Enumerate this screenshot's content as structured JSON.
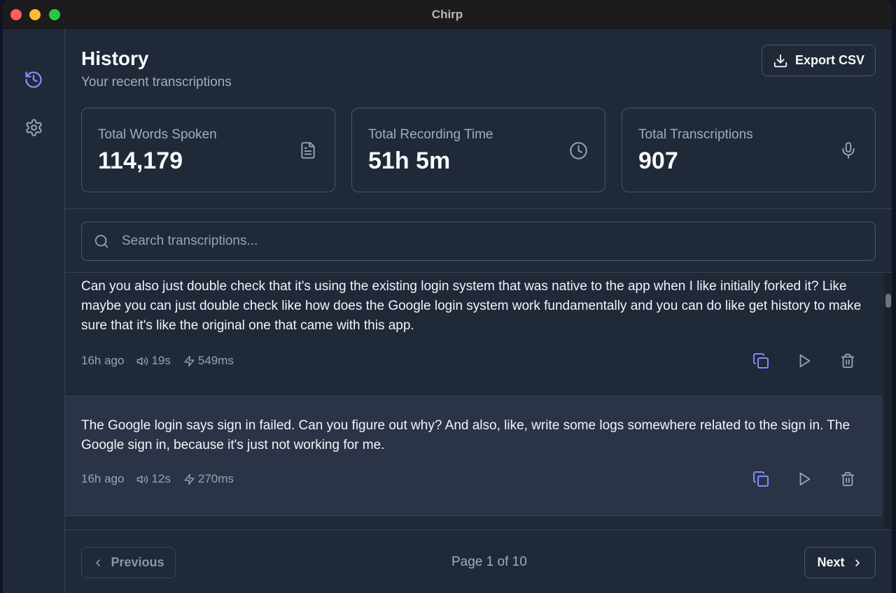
{
  "window": {
    "title": "Chirp"
  },
  "sidebar": {
    "items": [
      {
        "name": "history",
        "icon": "history-icon",
        "active": true
      },
      {
        "name": "settings",
        "icon": "gear-icon",
        "active": false
      }
    ]
  },
  "header": {
    "title": "History",
    "subtitle": "Your recent transcriptions",
    "export_label": "Export CSV"
  },
  "stats": [
    {
      "label": "Total Words Spoken",
      "value": "114,179",
      "icon": "document-icon"
    },
    {
      "label": "Total Recording Time",
      "value": "51h 5m",
      "icon": "clock-icon"
    },
    {
      "label": "Total Transcriptions",
      "value": "907",
      "icon": "microphone-icon"
    }
  ],
  "search": {
    "placeholder": "Search transcriptions...",
    "value": ""
  },
  "transcriptions": [
    {
      "text": "Can you also just double check that it's using the existing login system that was native to the app when I like initially forked it? Like maybe you can just double check like how does the Google login system work fundamentally and you can do like get history to make sure that it's like the original one that came with this app.",
      "time": "16h ago",
      "duration": "19s",
      "latency": "549ms"
    },
    {
      "text": "The Google login says sign in failed. Can you figure out why? And also, like, write some logs somewhere related to the sign in. The Google sign in, because it's just not working for me.",
      "time": "16h ago",
      "duration": "12s",
      "latency": "270ms"
    }
  ],
  "pagination": {
    "previous_label": "Previous",
    "page_text": "Page 1 of 10",
    "next_label": "Next"
  },
  "colors": {
    "accent": "#818cf8",
    "background": "#1f2937",
    "border": "#4b5563",
    "highlight_row": "#2b3446"
  }
}
